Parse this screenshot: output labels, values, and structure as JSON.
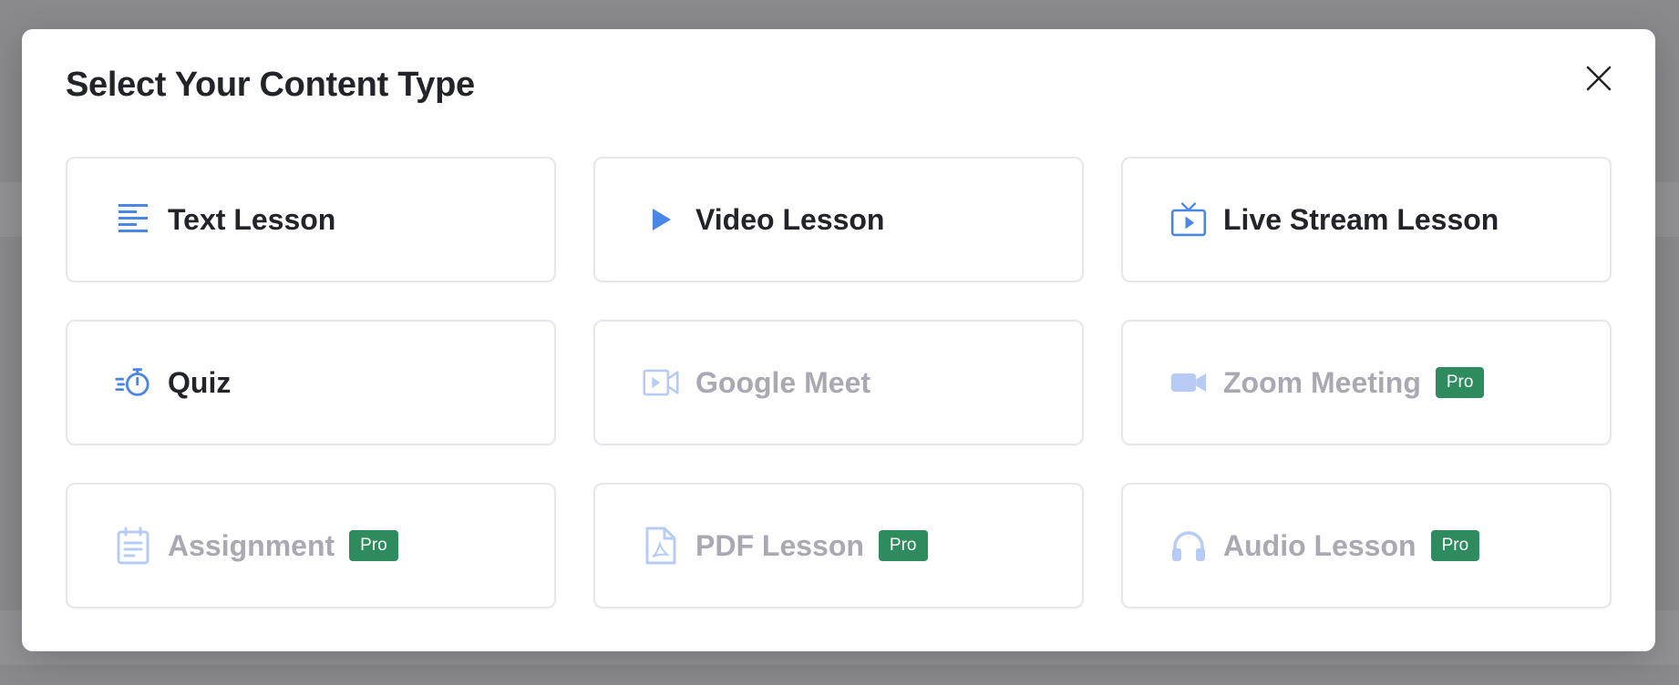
{
  "modal": {
    "title": "Select Your Content Type",
    "close_icon": "close-icon"
  },
  "colors": {
    "accent": "#4a86e8",
    "accent_disabled": "#b7ccf5",
    "pro_badge": "#2e8b5e"
  },
  "content_types": [
    {
      "label": "Text Lesson",
      "icon": "text-lines-icon",
      "enabled": true,
      "badge": ""
    },
    {
      "label": "Video Lesson",
      "icon": "play-icon",
      "enabled": true,
      "badge": ""
    },
    {
      "label": "Live Stream Lesson",
      "icon": "tv-play-icon",
      "enabled": true,
      "badge": ""
    },
    {
      "label": "Quiz",
      "icon": "stopwatch-icon",
      "enabled": true,
      "badge": ""
    },
    {
      "label": "Google Meet",
      "icon": "video-camera-outline-icon",
      "enabled": false,
      "badge": ""
    },
    {
      "label": "Zoom Meeting",
      "icon": "video-camera-icon",
      "enabled": false,
      "badge": "Pro"
    },
    {
      "label": "Assignment",
      "icon": "clipboard-icon",
      "enabled": false,
      "badge": "Pro"
    },
    {
      "label": "PDF Lesson",
      "icon": "pdf-file-icon",
      "enabled": false,
      "badge": "Pro"
    },
    {
      "label": "Audio Lesson",
      "icon": "headphones-icon",
      "enabled": false,
      "badge": "Pro"
    }
  ]
}
